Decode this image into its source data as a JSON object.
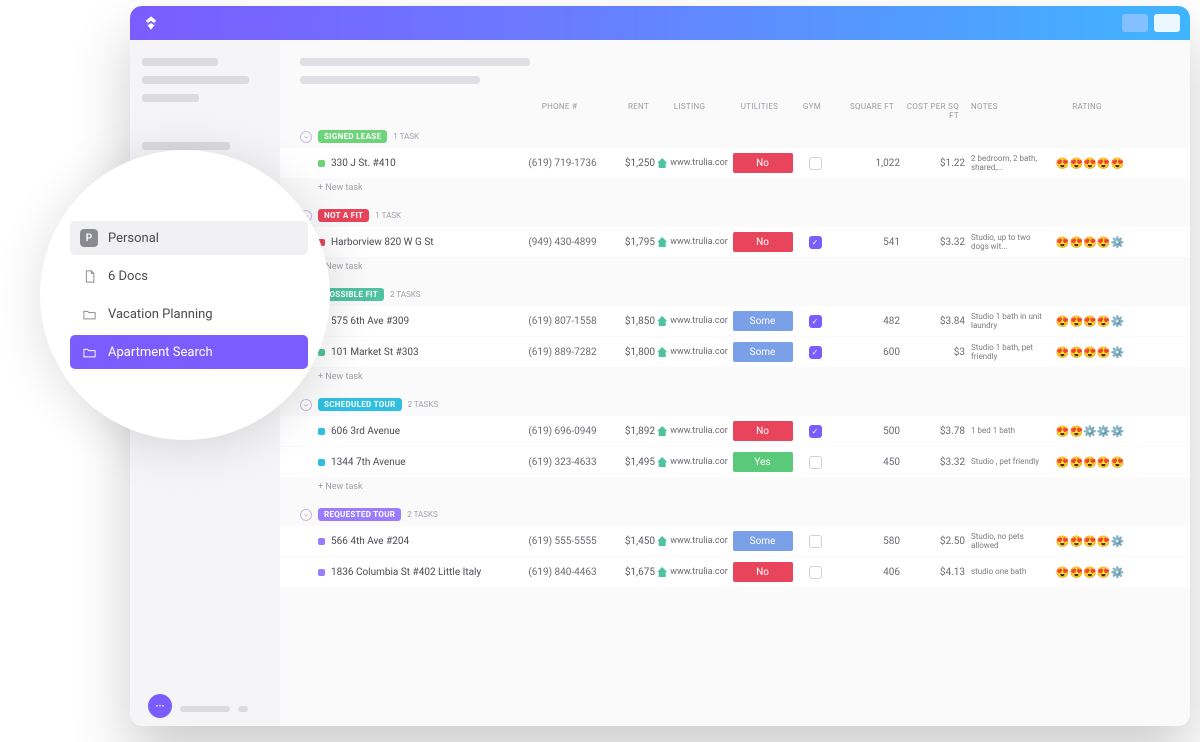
{
  "bubble": {
    "personal": {
      "icon": "P",
      "label": "Personal"
    },
    "docs": {
      "label": "6 Docs"
    },
    "vacation": {
      "label": "Vacation Planning"
    },
    "apartment": {
      "label": "Apartment Search"
    }
  },
  "columns": {
    "phone": "PHONE #",
    "rent": "RENT",
    "listing": "LISTING",
    "utilities": "UTILITIES",
    "gym": "GYM",
    "sqft": "SQUARE FT",
    "cost": "COST PER SQ FT",
    "notes": "NOTES",
    "rating": "RATING"
  },
  "new_task": "+ New task",
  "colors": {
    "signed": "#6ed47a",
    "notfit": "#e8445b",
    "possible": "#4fc3a1",
    "scheduled": "#2fbfe0",
    "requested": "#9b7cff",
    "util_no": "#e8445b",
    "util_yes": "#5bc97a",
    "util_some": "#7aa0e8"
  },
  "sq": {
    "green": "#6ed47a",
    "red": "#e8445b",
    "teal": "#4fc3a1",
    "blue": "#2fbfe0",
    "purple": "#9b7cff"
  },
  "groups": [
    {
      "id": "signed",
      "label": "SIGNED LEASE",
      "count": "1 TASK",
      "rows": [
        {
          "sq": "green",
          "name": "330 J St. #410",
          "phone": "(619) 719-1736",
          "rent": "$1,250",
          "listing": "www.trulia.cor",
          "util": "No",
          "util_c": "util_no",
          "gym": false,
          "sqft": "1,022",
          "cost": "$1.22",
          "notes": "2 bedroom, 2 bath, shared,...",
          "rating": "😍😍😍😍😍"
        }
      ]
    },
    {
      "id": "notfit",
      "label": "NOT A FIT",
      "count": "1 TASK",
      "rows": [
        {
          "sq": "red",
          "name": "Harborview 820 W G St",
          "phone": "(949) 430-4899",
          "rent": "$1,795",
          "listing": "www.trulia.cor",
          "util": "No",
          "util_c": "util_no",
          "gym": true,
          "sqft": "541",
          "cost": "$3.32",
          "notes": "Studio, up to two dogs wit...",
          "rating": "😍😍😍😍⚙️"
        }
      ]
    },
    {
      "id": "possible",
      "label": "POSSIBLE FIT",
      "count": "2 TASKS",
      "rows": [
        {
          "sq": "teal",
          "name": "575 6th Ave #309",
          "phone": "(619) 807-1558",
          "rent": "$1,850",
          "listing": "www.trulia.cor",
          "util": "Some",
          "util_c": "util_some",
          "gym": true,
          "sqft": "482",
          "cost": "$3.84",
          "notes": "Studio 1 bath in unit laundry",
          "rating": "😍😍😍😍⚙️"
        },
        {
          "sq": "teal",
          "name": "101 Market St #303",
          "phone": "(619) 889-7282",
          "rent": "$1,800",
          "listing": "www.trulia.cor",
          "util": "Some",
          "util_c": "util_some",
          "gym": true,
          "sqft": "600",
          "cost": "$3",
          "notes": "Studio 1 bath, pet friendly",
          "rating": "😍😍😍😍⚙️"
        }
      ]
    },
    {
      "id": "scheduled",
      "label": "SCHEDULED TOUR",
      "count": "2 TASKS",
      "rows": [
        {
          "sq": "blue",
          "name": "606 3rd Avenue",
          "phone": "(619) 696-0949",
          "rent": "$1,892",
          "listing": "www.trulia.cor",
          "util": "No",
          "util_c": "util_no",
          "gym": true,
          "sqft": "500",
          "cost": "$3.78",
          "notes": "1 bed 1 bath",
          "rating": "😍😍⚙️⚙️⚙️"
        },
        {
          "sq": "blue",
          "name": "1344 7th Avenue",
          "phone": "(619) 323-4633",
          "rent": "$1,495",
          "listing": "www.trulia.cor",
          "util": "Yes",
          "util_c": "util_yes",
          "gym": false,
          "sqft": "450",
          "cost": "$3.32",
          "notes": "Studio , pet friendly",
          "rating": "😍😍😍😍😍"
        }
      ]
    },
    {
      "id": "requested",
      "label": "REQUESTED TOUR",
      "count": "2 TASKS",
      "rows": [
        {
          "sq": "purple",
          "name": "566 4th Ave #204",
          "phone": "(619) 555-5555",
          "rent": "$1,450",
          "listing": "www.trulia.cor",
          "util": "Some",
          "util_c": "util_some",
          "gym": false,
          "sqft": "580",
          "cost": "$2.50",
          "notes": "Studio, no pets allowed",
          "rating": "😍😍😍😍⚙️"
        },
        {
          "sq": "purple",
          "name": "1836 Columbia St #402 Little Italy",
          "phone": "(619) 840-4463",
          "rent": "$1,675",
          "listing": "www.trulia.cor",
          "util": "No",
          "util_c": "util_no",
          "gym": false,
          "sqft": "406",
          "cost": "$4.13",
          "notes": "studio one bath",
          "rating": "😍😍😍😍⚙️"
        }
      ]
    }
  ]
}
